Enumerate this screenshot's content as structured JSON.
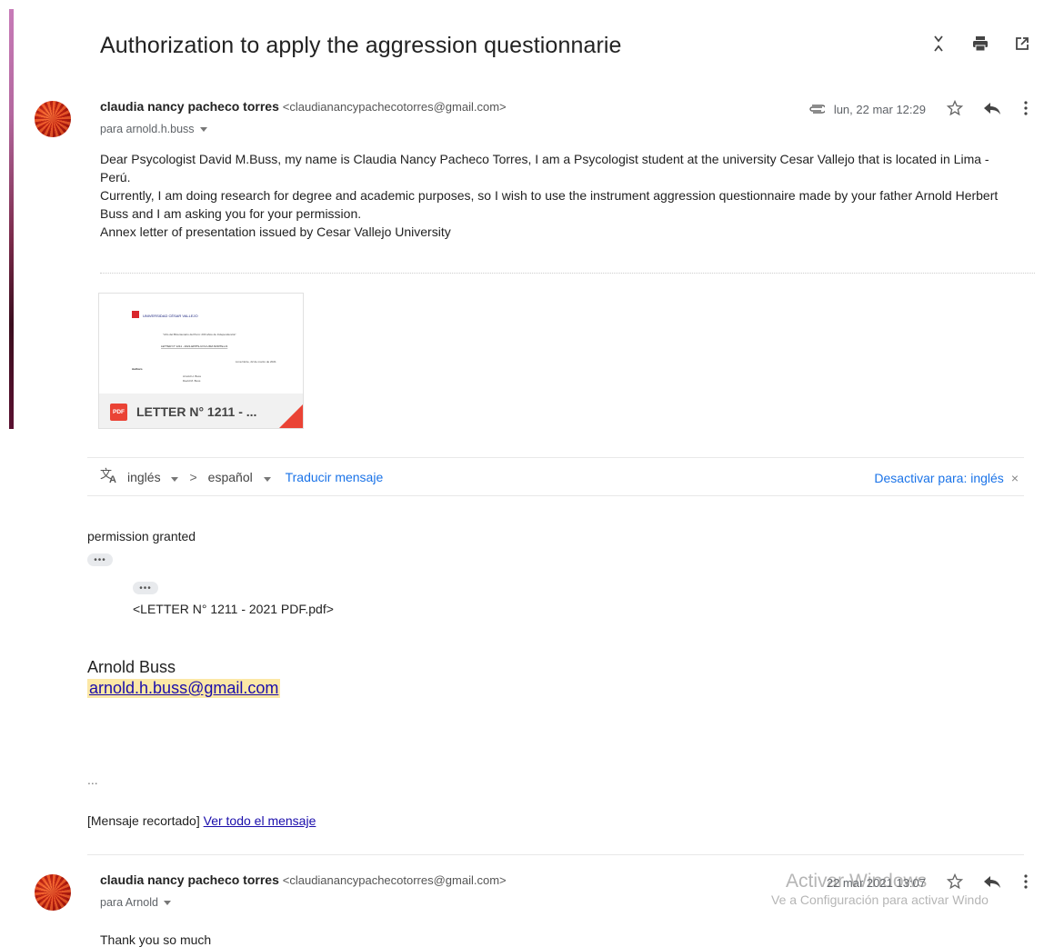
{
  "email": {
    "subject": "Authorization to apply the aggression questionnarie",
    "toolbar": {
      "collapse_icon": "collapse-icon",
      "print_icon": "print-icon",
      "new_window_icon": "open-in-new-icon"
    },
    "message1": {
      "sender_name": "claudia nancy pacheco torres",
      "sender_email": "<claudianancypachecotorres@gmail.com>",
      "to": "para arnold.h.buss",
      "date": "lun, 22 mar 12:29",
      "body": [
        "Dear Psycologist David M.Buss, my name is Claudia Nancy Pacheco Torres, I am a Psycologist student at the university Cesar Vallejo that is located in Lima - Perú.",
        "Currently, I am doing research for  degree and academic purposes, so I wish to use the instrument aggression questionnaire made by your father Arnold Herbert Buss and I am asking you for your permission.",
        "Annex letter of presentation issued by Cesar Vallejo University"
      ],
      "attachment": {
        "badge": "PDF",
        "name": "LETTER N° 1211 - ...",
        "preview": {
          "university": "UNIVERSIDAD CÉSAR VALLEJO",
          "motto": "\"Año del Bicentenario del Perú: 200 años de Independencia\"",
          "ref": "LETTER N° 1211 - 2021-EP/PS-UCV-LIMA NORTE-LN",
          "place_date": "Lima Norte, 22 de marzo de 2021",
          "salutation": "Authors",
          "line1": "Arnold H. Buss",
          "line2": "David M. Buss"
        }
      }
    },
    "translate": {
      "from": "inglés",
      "to": "español",
      "action": "Traducir mensaje",
      "disable": "Desactivar para: inglés"
    },
    "message2": {
      "reply": "permission granted",
      "ellipsis": "•••",
      "attachment_ref": "<LETTER N° 1211 - 2021 PDF.pdf>",
      "signature_name": "Arnold Buss",
      "signature_email": "arnold.h.buss@gmail.com",
      "trailing": "...",
      "clipped_label": "[Mensaje recortado]",
      "view_full": "Ver todo el mensaje"
    },
    "message3": {
      "sender_name": "claudia nancy pacheco torres",
      "sender_email": "<claudianancypachecotorres@gmail.com>",
      "to": "para Arnold",
      "date": "22 mar 2021 13:07",
      "body": "Thank you so much"
    }
  },
  "watermark": {
    "title": "Activar Windows",
    "subtitle": "Ve a Configuración para activar Windo"
  }
}
